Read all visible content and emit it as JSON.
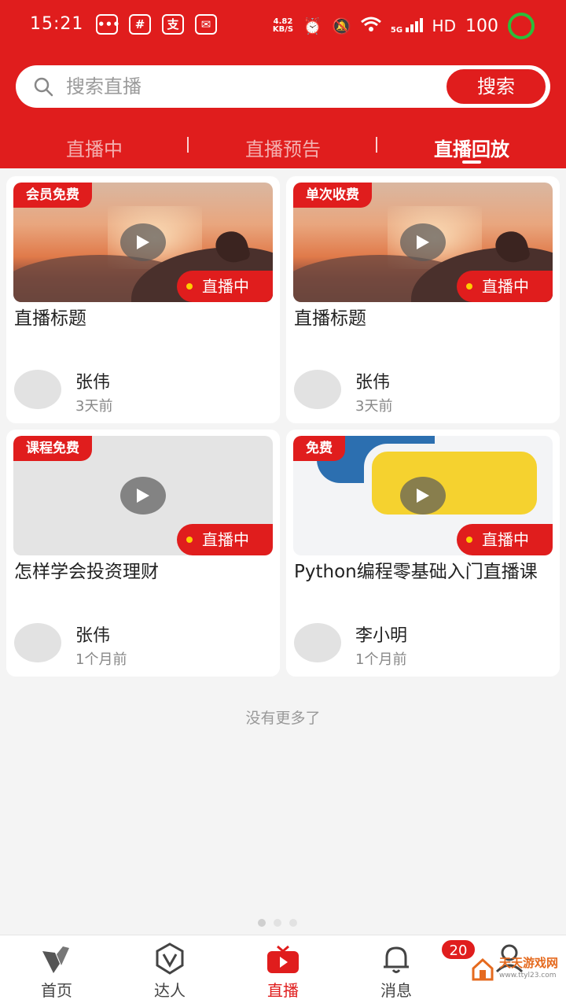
{
  "status_bar": {
    "time": "15:21",
    "net_speed_top": "4.82",
    "net_speed_bottom": "KB/S",
    "signal": "5G",
    "hd": "HD",
    "battery": "100",
    "app_icons": [
      "wechat-icon",
      "hash-icon",
      "alipay-icon",
      "mail-icon"
    ]
  },
  "search": {
    "placeholder": "搜索直播",
    "button_label": "搜索"
  },
  "tabs": [
    {
      "label": "直播中",
      "active": false
    },
    {
      "label": "直播预告",
      "active": false
    },
    {
      "label": "直播回放",
      "active": true
    }
  ],
  "cards": [
    {
      "badge": "会员免费",
      "live_label": "直播中",
      "title": "直播标题",
      "author": "张伟",
      "time": "3天前",
      "thumb": "sunset"
    },
    {
      "badge": "单次收费",
      "live_label": "直播中",
      "title": "直播标题",
      "author": "张伟",
      "time": "3天前",
      "thumb": "sunset"
    },
    {
      "badge": "课程免费",
      "live_label": "直播中",
      "title": "怎样学会投资理财",
      "author": "张伟",
      "time": "1个月前",
      "thumb": "gray"
    },
    {
      "badge": "免费",
      "live_label": "直播中",
      "title": "Python编程零基础入门直播课",
      "author": "李小明",
      "time": "1个月前",
      "thumb": "python"
    }
  ],
  "no_more": "没有更多了",
  "bottom_nav": [
    {
      "label": "首页",
      "icon": "home-logo-icon",
      "active": false
    },
    {
      "label": "达人",
      "icon": "expert-badge-icon",
      "active": false
    },
    {
      "label": "直播",
      "icon": "tv-play-icon",
      "active": true
    },
    {
      "label": "消息",
      "icon": "bell-icon",
      "active": false,
      "badge": "20"
    },
    {
      "label": "",
      "icon": "user-icon",
      "active": false
    }
  ],
  "watermark": {
    "text": "天天游戏网",
    "sub": "www.ttyl23.com"
  },
  "colors": {
    "accent": "#e01d1d",
    "live_dot": "#ffcc00"
  }
}
